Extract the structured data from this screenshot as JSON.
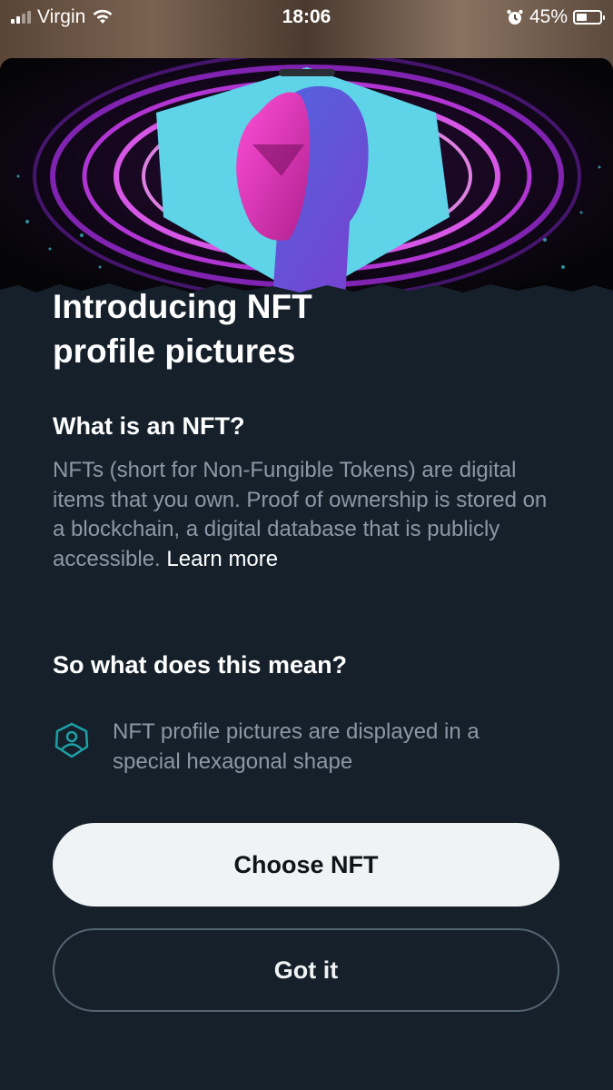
{
  "status_bar": {
    "carrier": "Virgin",
    "time": "18:06",
    "battery": "45%",
    "battery_level": 0.45
  },
  "sheet": {
    "title_line1": "Introducing NFT",
    "title_line2": "profile pictures",
    "section1_heading": "What is an NFT?",
    "section1_text": "NFTs (short for Non-Fungible Tokens) are digital items that you own. Proof of ownership is stored on a blockchain, a digital database that is publicly accessible. ",
    "learn_more": "Learn more",
    "section2_heading": "So what does this mean?",
    "features": [
      {
        "icon": "hexagon-user-icon",
        "text": "NFT profile pictures are displayed in a special hexagonal shape"
      }
    ]
  },
  "buttons": {
    "primary": "Choose NFT",
    "secondary": "Got it"
  },
  "colors": {
    "background": "#15202b",
    "muted_text": "#8b98a5",
    "accent_teal": "#1da1a8",
    "hero_magenta": "#d62cc0",
    "hero_cyan": "#5fd3e8"
  }
}
